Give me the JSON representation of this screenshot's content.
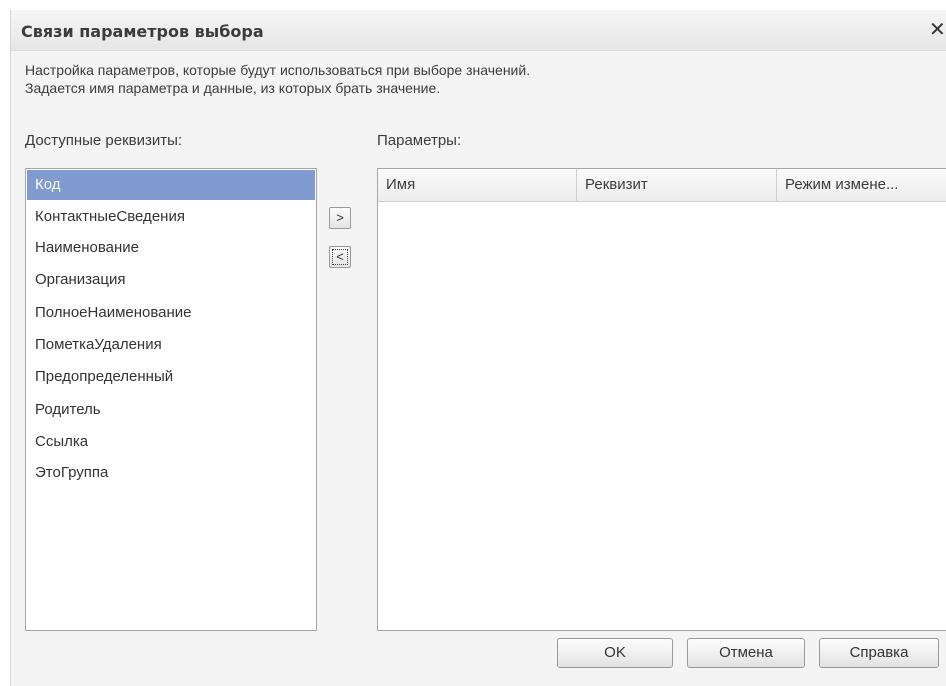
{
  "dialog": {
    "title": "Связи параметров выбора",
    "close_label": "✕",
    "description_line1": "Настройка параметров, которые будут использоваться при выборе значений.",
    "description_line2": "Задается имя параметра и данные, из которых брать значение."
  },
  "available": {
    "label": "Доступные реквизиты:",
    "items": [
      "Код",
      "КонтактныеСведения",
      "Наименование",
      "Организация",
      "ПолноеНаименование",
      "ПометкаУдаления",
      "Предопределенный",
      "Родитель",
      "Ссылка",
      "ЭтоГруппа"
    ],
    "selected_item": "Код"
  },
  "transfer": {
    "add_label": ">",
    "remove_label": "<"
  },
  "parameters": {
    "label": "Параметры:",
    "columns": [
      "Имя",
      "Реквизит",
      "Режим измене..."
    ],
    "rows": []
  },
  "buttons": {
    "ok": "OK",
    "cancel": "Отмена",
    "help": "Справка"
  }
}
